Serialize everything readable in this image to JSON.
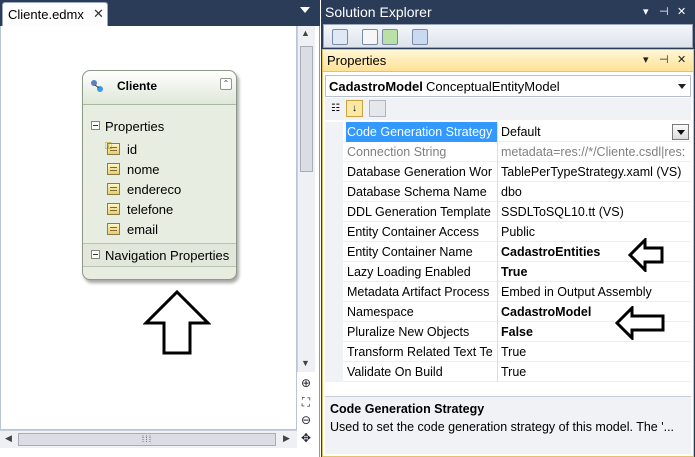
{
  "document": {
    "tab_title": "Cliente.edmx",
    "close_glyph": "✕"
  },
  "entity": {
    "name": "Cliente",
    "properties_section": "Properties",
    "navigation_section": "Navigation Properties",
    "properties": [
      {
        "name": "id",
        "is_key": true,
        "icon": "key-property-icon"
      },
      {
        "name": "nome",
        "is_key": false,
        "icon": "property-icon"
      },
      {
        "name": "endereco",
        "is_key": false,
        "icon": "property-icon"
      },
      {
        "name": "telefone",
        "is_key": false,
        "icon": "property-icon"
      },
      {
        "name": "email",
        "is_key": false,
        "icon": "property-icon"
      }
    ]
  },
  "solution_explorer": {
    "title": "Solution Explorer"
  },
  "properties_window": {
    "title": "Properties",
    "object_name": "CadastroModel",
    "object_type": "ConceptualEntityModel",
    "rows": [
      {
        "name": "Code Generation Strategy",
        "value": "Default",
        "state": "selected"
      },
      {
        "name": "Connection String",
        "value": "metadata=res://*/Cliente.csdl|res:",
        "state": "disabled"
      },
      {
        "name": "Database Generation Wor",
        "value": "TablePerTypeStrategy.xaml (VS)",
        "state": "normal"
      },
      {
        "name": "Database Schema Name",
        "value": "dbo",
        "state": "normal"
      },
      {
        "name": "DDL Generation Template",
        "value": "SSDLToSQL10.tt (VS)",
        "state": "normal"
      },
      {
        "name": "Entity Container Access",
        "value": "Public",
        "state": "normal"
      },
      {
        "name": "Entity Container Name",
        "value": "CadastroEntities",
        "state": "bold"
      },
      {
        "name": "Lazy Loading Enabled",
        "value": "True",
        "state": "bold"
      },
      {
        "name": "Metadata Artifact Process",
        "value": "Embed in Output Assembly",
        "state": "normal"
      },
      {
        "name": "Namespace",
        "value": "CadastroModel",
        "state": "bold"
      },
      {
        "name": "Pluralize New Objects",
        "value": "False",
        "state": "bold"
      },
      {
        "name": "Transform Related Text Te",
        "value": "True",
        "state": "normal"
      },
      {
        "name": "Validate On Build",
        "value": "True",
        "state": "normal"
      }
    ],
    "description_title": "Code Generation Strategy",
    "description_text": "Used to set the code generation strategy of this model. The '..."
  },
  "colors": {
    "ide_frame": "#2b3c59",
    "selection": "#3399ff",
    "tool_window_title": "#ffe295",
    "entity_fill": "#e8ede2"
  },
  "icons": {
    "window_buttons": [
      "dropdown-icon",
      "pin-icon",
      "close-icon"
    ],
    "zoom_tools": [
      "zoom-in-icon",
      "zoom-fit-icon",
      "zoom-out-icon",
      "pan-icon"
    ]
  }
}
